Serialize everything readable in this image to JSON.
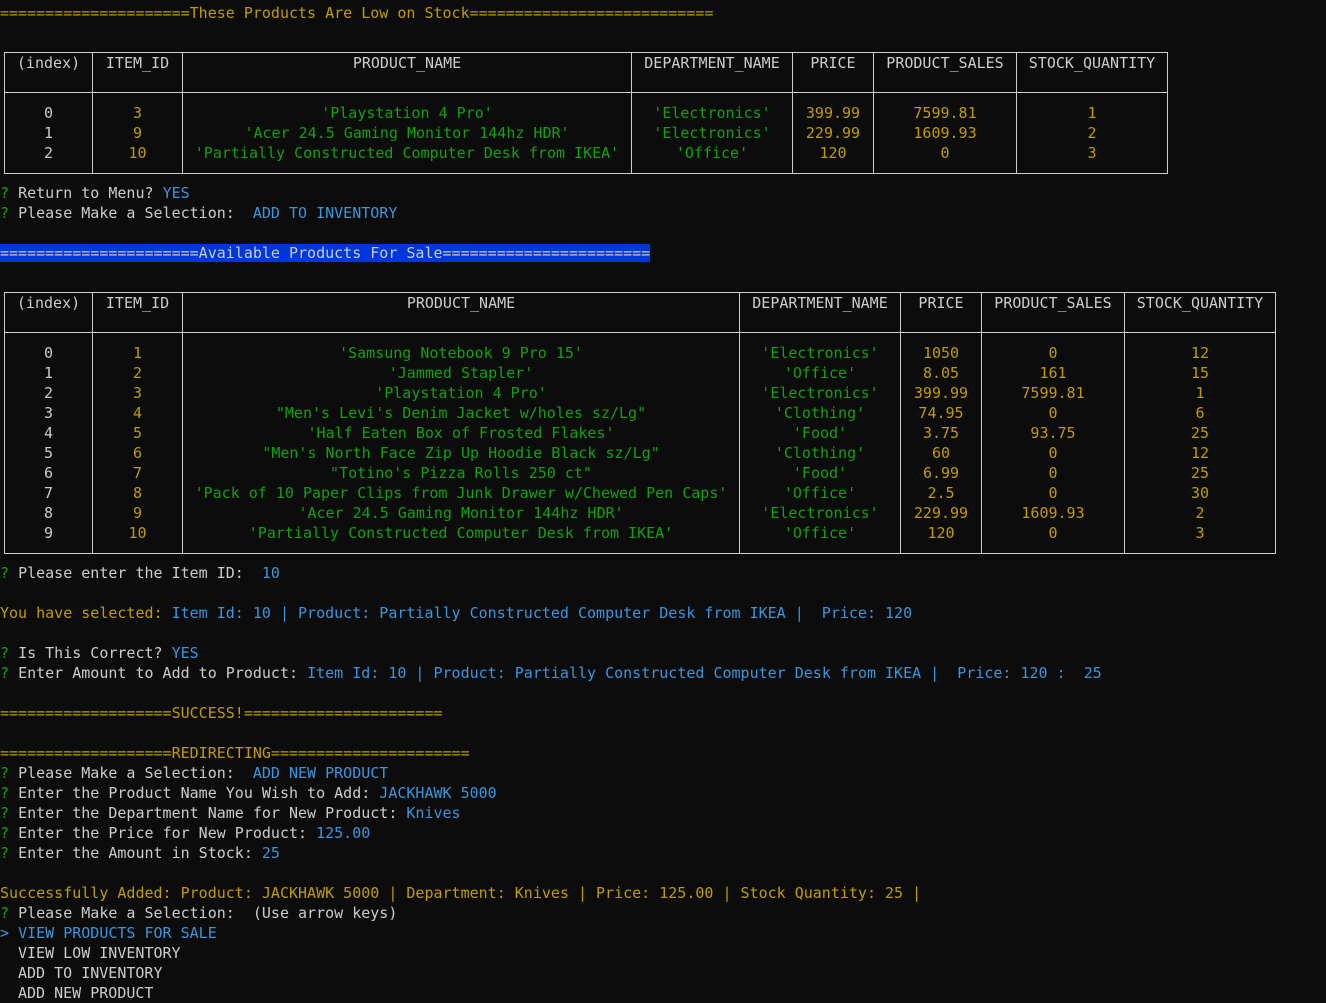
{
  "low_stock": {
    "banner": "=====================These Products Are Low on Stock===========================",
    "headers": [
      "(index)",
      "ITEM_ID",
      "PRODUCT_NAME",
      "DEPARTMENT_NAME",
      "PRICE",
      "PRODUCT_SALES",
      "STOCK_QUANTITY"
    ],
    "rows": [
      {
        "index": "0",
        "item_id": "3",
        "product_name": "'Playstation 4 Pro'",
        "department_name": "'Electronics'",
        "price": "399.99",
        "product_sales": "7599.81",
        "stock_quantity": "1"
      },
      {
        "index": "1",
        "item_id": "9",
        "product_name": "'Acer 24.5 Gaming Monitor 144hz HDR'",
        "department_name": "'Electronics'",
        "price": "229.99",
        "product_sales": "1609.93",
        "stock_quantity": "2"
      },
      {
        "index": "2",
        "item_id": "10",
        "product_name": "'Partially Constructed Computer Desk from IKEA'",
        "department_name": "'Office'",
        "price": "120",
        "product_sales": "0",
        "stock_quantity": "3"
      }
    ]
  },
  "prompts1": {
    "return_menu_q": "Return to Menu?",
    "return_menu_a": "YES",
    "selection_q": "Please Make a Selection:",
    "selection_a": "ADD TO INVENTORY"
  },
  "available": {
    "banner": "======================Available Products For Sale=======================",
    "headers": [
      "(index)",
      "ITEM_ID",
      "PRODUCT_NAME",
      "DEPARTMENT_NAME",
      "PRICE",
      "PRODUCT_SALES",
      "STOCK_QUANTITY"
    ],
    "rows": [
      {
        "index": "0",
        "item_id": "1",
        "product_name": "'Samsung Notebook 9 Pro 15'",
        "department_name": "'Electronics'",
        "price": "1050",
        "product_sales": "0",
        "stock_quantity": "12"
      },
      {
        "index": "1",
        "item_id": "2",
        "product_name": "'Jammed Stapler'",
        "department_name": "'Office'",
        "price": "8.05",
        "product_sales": "161",
        "stock_quantity": "15"
      },
      {
        "index": "2",
        "item_id": "3",
        "product_name": "'Playstation 4 Pro'",
        "department_name": "'Electronics'",
        "price": "399.99",
        "product_sales": "7599.81",
        "stock_quantity": "1"
      },
      {
        "index": "3",
        "item_id": "4",
        "product_name": "\"Men's Levi's Denim Jacket w/holes sz/Lg\"",
        "department_name": "'Clothing'",
        "price": "74.95",
        "product_sales": "0",
        "stock_quantity": "6"
      },
      {
        "index": "4",
        "item_id": "5",
        "product_name": "'Half Eaten Box of Frosted Flakes'",
        "department_name": "'Food'",
        "price": "3.75",
        "product_sales": "93.75",
        "stock_quantity": "25"
      },
      {
        "index": "5",
        "item_id": "6",
        "product_name": "\"Men's North Face Zip Up Hoodie Black sz/Lg\"",
        "department_name": "'Clothing'",
        "price": "60",
        "product_sales": "0",
        "stock_quantity": "12"
      },
      {
        "index": "6",
        "item_id": "7",
        "product_name": "\"Totino's Pizza Rolls 250 ct\"",
        "department_name": "'Food'",
        "price": "6.99",
        "product_sales": "0",
        "stock_quantity": "25"
      },
      {
        "index": "7",
        "item_id": "8",
        "product_name": "'Pack of 10 Paper Clips from Junk Drawer w/Chewed Pen Caps'",
        "department_name": "'Office'",
        "price": "2.5",
        "product_sales": "0",
        "stock_quantity": "30"
      },
      {
        "index": "8",
        "item_id": "9",
        "product_name": "'Acer 24.5 Gaming Monitor 144hz HDR'",
        "department_name": "'Electronics'",
        "price": "229.99",
        "product_sales": "1609.93",
        "stock_quantity": "2"
      },
      {
        "index": "9",
        "item_id": "10",
        "product_name": "'Partially Constructed Computer Desk from IKEA'",
        "department_name": "'Office'",
        "price": "120",
        "product_sales": "0",
        "stock_quantity": "3"
      }
    ]
  },
  "prompts2": {
    "item_id_q": "Please enter the Item ID:",
    "item_id_a": "10",
    "selected_label": "You have selected:",
    "selected_value": "Item Id: 10 | Product: Partially Constructed Computer Desk from IKEA |  Price: 120",
    "correct_q": "Is This Correct?",
    "correct_a": "YES",
    "amount_q": "Enter Amount to Add to Product:",
    "amount_context": "Item Id: 10 | Product: Partially Constructed Computer Desk from IKEA |  Price: 120 :",
    "amount_a": "25"
  },
  "success_banner": "===================SUCCESS!======================",
  "redirect_banner": "===================REDIRECTING======================",
  "prompts3": {
    "selection_q": "Please Make a Selection:",
    "selection_a": "ADD NEW PRODUCT",
    "name_q": "Enter the Product Name You Wish to Add:",
    "name_a": "JACKHAWK 5000",
    "dept_q": "Enter the Department Name for New Product:",
    "dept_a": "Knives",
    "price_q": "Enter the Price for New Product:",
    "price_a": "125.00",
    "stock_q": "Enter the Amount in Stock:",
    "stock_a": "25"
  },
  "added_message": "Successfully Added: Product: JACKHAWK 5000 | Department: Knives | Price: 125.00 | Stock Quantity: 25 |",
  "menu": {
    "question": "Please Make a Selection:",
    "hint": "(Use arrow keys)",
    "pointer": ">",
    "options": [
      "VIEW PRODUCTS FOR SALE",
      "VIEW LOW INVENTORY",
      "ADD TO INVENTORY",
      "ADD NEW PRODUCT"
    ]
  },
  "qmark": "?",
  "colors": {
    "background": "#0c0c0c",
    "text": "#cccccc",
    "yellow": "#c19c00",
    "green": "#13a10e",
    "blue": "#3b78ff",
    "selection": "#0037da"
  }
}
